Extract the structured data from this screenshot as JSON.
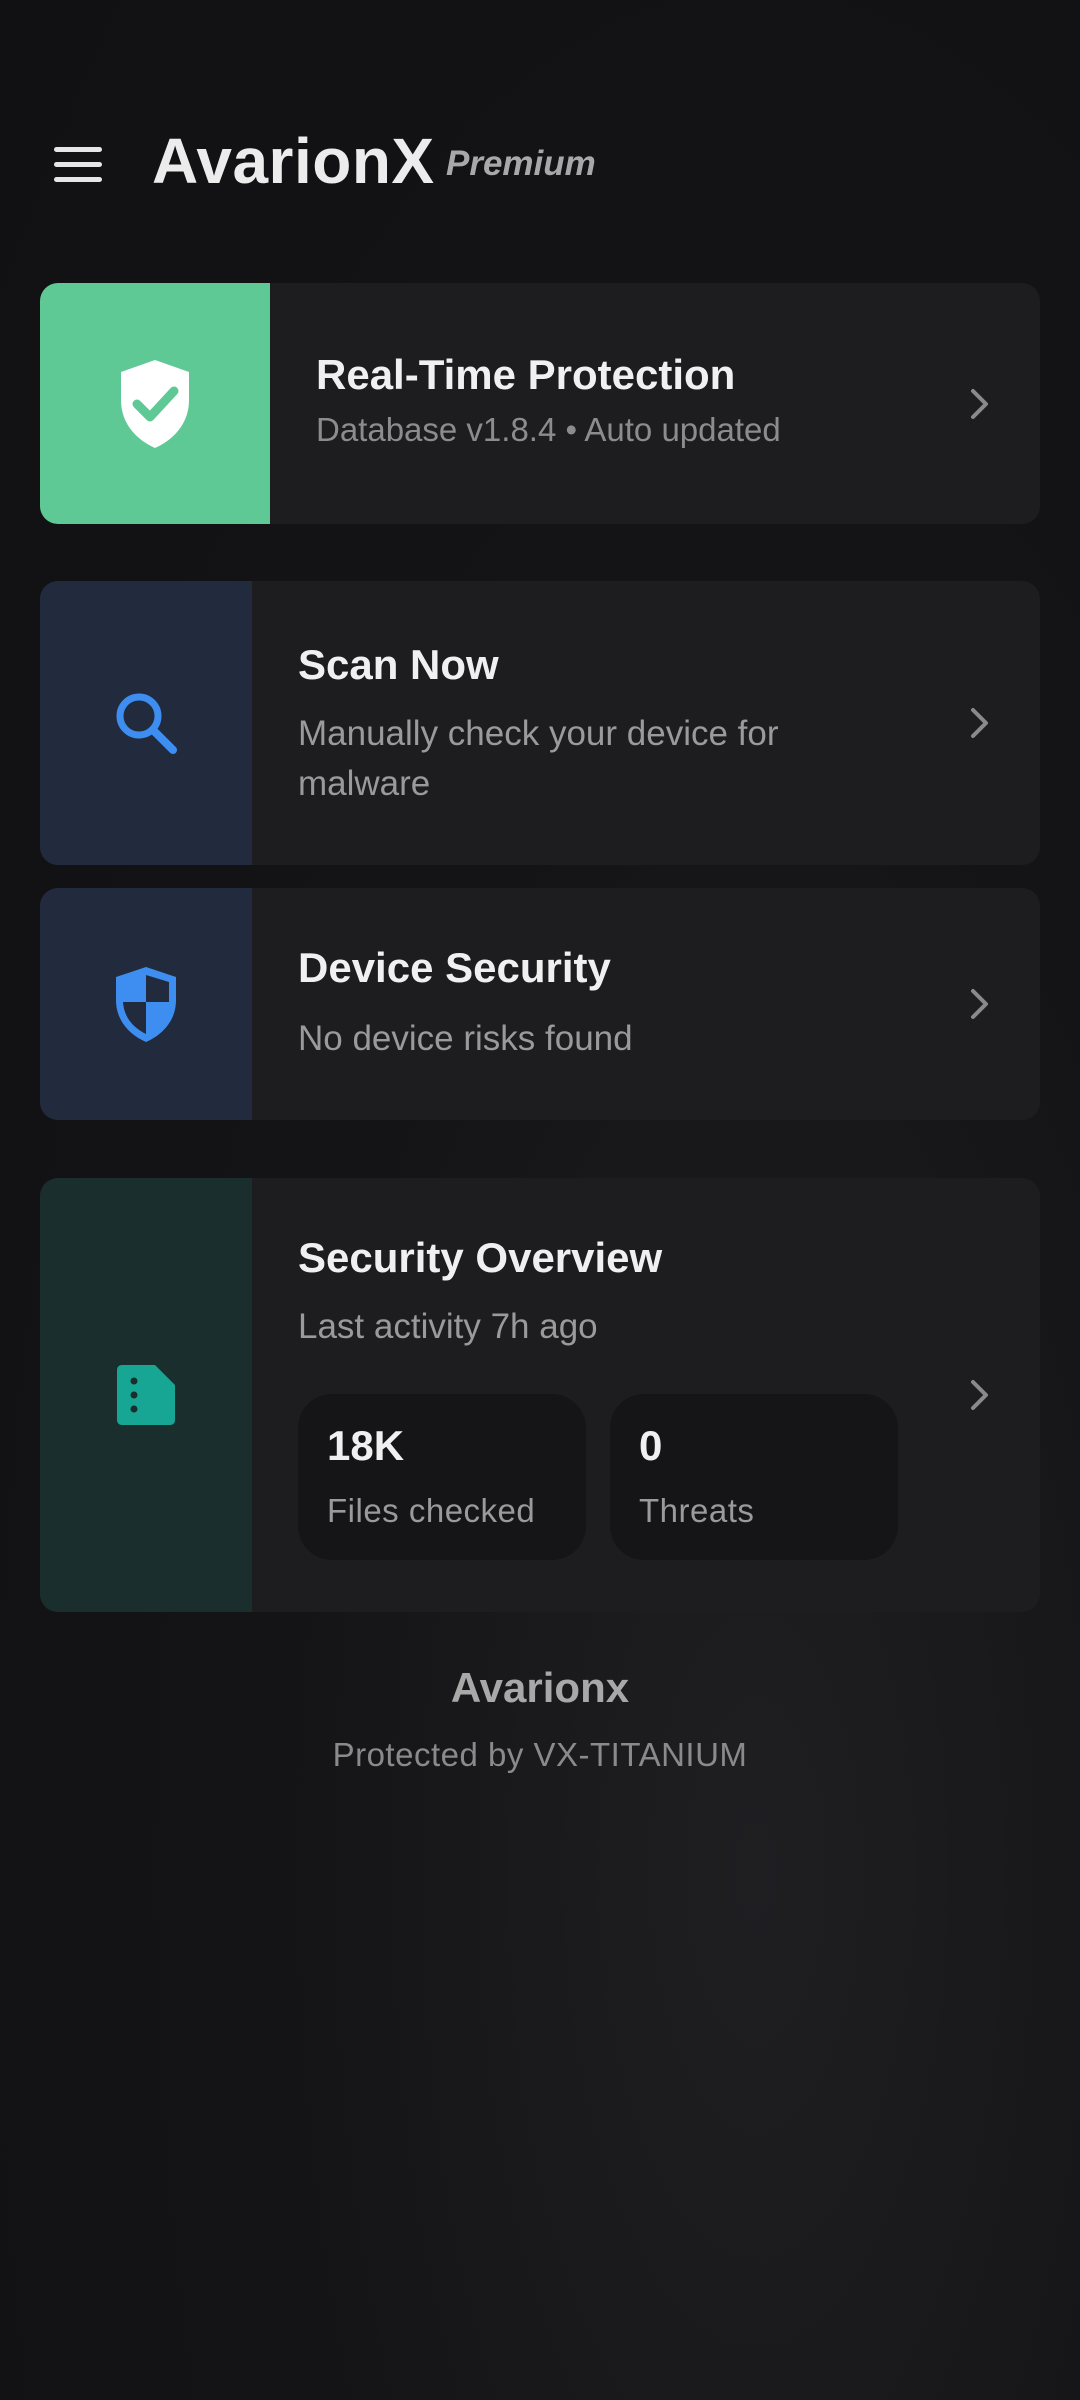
{
  "header": {
    "app_title": "AvarionX",
    "tier": "Premium",
    "menu_icon": "hamburger-menu-icon"
  },
  "cards": {
    "real_time_protection": {
      "title": "Real-Time Protection",
      "subtitle": "Database v1.8.4 • Auto updated",
      "icon": "shield-check-icon",
      "tile_color": "#5ec994"
    },
    "scan_now": {
      "title": "Scan Now",
      "subtitle": "Manually check your device for malware",
      "icon": "search-icon",
      "tile_color": "#222b3d"
    },
    "device_security": {
      "title": "Device Security",
      "subtitle": "No device risks found",
      "icon": "security-shield-icon",
      "tile_color": "#222b3d"
    },
    "security_overview": {
      "title": "Security Overview",
      "subtitle": "Last activity 7h ago",
      "icon": "document-icon",
      "tile_color": "#1a2e2e",
      "stats": [
        {
          "value": "18K",
          "label": "Files checked"
        },
        {
          "value": "0",
          "label": "Threats"
        }
      ]
    }
  },
  "footer": {
    "brand": "Avarionx",
    "tagline": "Protected by VX-TITANIUM"
  },
  "colors": {
    "accent_green": "#5ec994",
    "accent_blue": "#3d8ef0",
    "accent_teal": "#17a594",
    "background": "#141416",
    "card": "#1d1d20"
  }
}
